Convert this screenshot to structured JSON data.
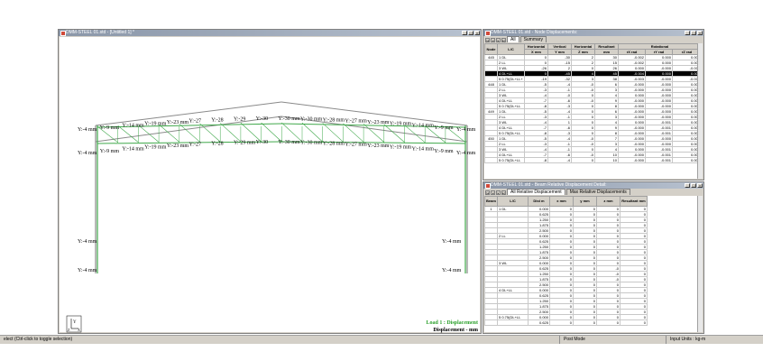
{
  "main_window": {
    "title": "DMM-STEEL 01.std - [Untitled 1] *",
    "title_buttons": [
      "_",
      "□",
      "×"
    ],
    "labels_top_row": [
      "Y:-4 mm",
      "Y:-9 mm",
      "Y:-14 mm",
      "Y:-19 mm",
      "Y:-23 mm",
      "Y:-27",
      "Y:-28",
      "Y:-29",
      "Y:-30",
      "Y:-30 mm",
      "Y:-30 mm",
      "Y:-28 mm",
      "Y:-27 mm",
      "Y:-23 mm",
      "Y:-19 mm",
      "Y:-14 mm",
      "Y:-9 mm",
      "Y:-4 mm"
    ],
    "labels_mid_row": [
      "Y:-4 mm",
      "Y:-9 mm",
      "Y:-14 mm",
      "Y:-19 mm",
      "Y:-23 mm",
      "Y:-27",
      "Y:-28",
      "Y:-29 mm",
      "Y:-30",
      "Y:-30 mm",
      "Y:-30 mm",
      "Y:-28 mm",
      "Y:-27 mm",
      "Y:-23 mm",
      "Y:-19 mm",
      "Y:-14 mm",
      "Y:-9 mm",
      "Y:-4 mm"
    ],
    "labels_low": [
      "Y:-4 mm",
      "Y:-4 mm"
    ],
    "labels_base": [
      "Y:-4 mm",
      "Y:-4 mm"
    ],
    "legend_line1": "Load 1 : Displacement",
    "legend_line2": "Displacement - mm",
    "axis_y": "Y",
    "axis_x": "X",
    "axis_z": "Z"
  },
  "node_disp": {
    "title": "DMM-STEEL 01.std - Node Displacements:",
    "tabs": [
      "All",
      "Summary"
    ],
    "header_groups": {
      "horizontal": "Horizontal",
      "vertical": "Vertical",
      "horizontal2": "Horizontal",
      "resultant": "Resultant",
      "rotational": "Rotational"
    },
    "columns": [
      "Node",
      "L/C",
      "X\nmm",
      "Y\nmm",
      "Z\nmm",
      "mm",
      "rX\nrad",
      "rY\nrad",
      "rZ\nrad"
    ],
    "rows": [
      [
        "445",
        "1 DL",
        "0",
        "-30",
        "2",
        "30",
        "-0.002",
        "0.000",
        "0.000"
      ],
      [
        "",
        "2 LL",
        "0",
        "-15",
        "2",
        "15",
        "-0.002",
        "0.000",
        "0.000"
      ],
      [
        "",
        "3 WL",
        "-26",
        "2",
        "0",
        "26",
        "0.000",
        "-0.000",
        "-0.000"
      ],
      [
        "",
        "4 DL+LL",
        "0",
        "-45",
        "4",
        "45",
        "-0.004",
        "0.000",
        "0.000"
      ],
      [
        "",
        "5 0.75(DL+LL+",
        "-19",
        "-32",
        "3",
        "38",
        "-0.003",
        "-0.000",
        "-0.000"
      ],
      [
        "448",
        "1 DL",
        "-5",
        "-4",
        "-0",
        "6",
        "-0.000",
        "-0.000",
        "0.001"
      ],
      [
        "",
        "2 LL",
        "-3",
        "-1",
        "-0",
        "3",
        "-0.000",
        "-0.000",
        "0.000"
      ],
      [
        "",
        "3 WL",
        "-4",
        "-0",
        "0",
        "4",
        "0.000",
        "-0.000",
        "0.003"
      ],
      [
        "",
        "4 DL+LL",
        "-7",
        "-6",
        "-0",
        "9",
        "-0.000",
        "-0.000",
        "0.001"
      ],
      [
        "",
        "5 0.75(DL+LL",
        "-8",
        "-3",
        "0",
        "8",
        "-0.000",
        "-0.000",
        "0.003"
      ],
      [
        "449",
        "1 DL",
        "-5",
        "-4",
        "0",
        "6",
        "-0.000",
        "-0.000",
        "0.001"
      ],
      [
        "",
        "2 LL",
        "-3",
        "-1",
        "0",
        "3",
        "-0.000",
        "-0.000",
        "0.000"
      ],
      [
        "",
        "3 WL",
        "-4",
        "1",
        "0",
        "4",
        "0.000",
        "-0.001",
        "0.003"
      ],
      [
        "",
        "4 DL+LL",
        "-7",
        "-6",
        "0",
        "9",
        "-0.000",
        "-0.001",
        "0.001"
      ],
      [
        "",
        "5 0.75(DL+LL",
        "-8",
        "-3",
        "0",
        "8",
        "-0.000",
        "-0.001",
        "0.003"
      ],
      [
        "450",
        "1 DL",
        "-5",
        "-4",
        "-0",
        "7",
        "-0.000",
        "-0.000",
        "0.001"
      ],
      [
        "",
        "2 LL",
        "-3",
        "-1",
        "-0",
        "3",
        "-0.000",
        "-0.000",
        "0.000"
      ],
      [
        "",
        "3 WL",
        "-4",
        "-1",
        "0",
        "4",
        "0.000",
        "-0.001",
        "0.003"
      ],
      [
        "",
        "4 DL+LL",
        "-7",
        "-6",
        "-0",
        "10",
        "-0.000",
        "-0.001",
        "0.001"
      ],
      [
        "",
        "5 0.75(DL+LL",
        "-8",
        "-4",
        "0",
        "10",
        "-0.000",
        "-0.001",
        "0.003"
      ]
    ]
  },
  "beam_disp": {
    "title": "DMM-STEEL 01.std - Beam Relative Displacement Detail:",
    "tabs": [
      "All Relative Displacement",
      "Max Relative Displacements"
    ],
    "columns": [
      "Beam",
      "L/C",
      "Dist\nm",
      "x\nmm",
      "y\nmm",
      "z\nmm",
      "Resultant\nmm"
    ],
    "rows": [
      [
        "1",
        "1 DL",
        "0.000",
        "0",
        "0",
        "0",
        "0"
      ],
      [
        "",
        "",
        "0.625",
        "0",
        "0",
        "0",
        "0"
      ],
      [
        "",
        "",
        "1.250",
        "0",
        "0",
        "0",
        "0"
      ],
      [
        "",
        "",
        "1.875",
        "0",
        "0",
        "0",
        "0"
      ],
      [
        "",
        "",
        "2.500",
        "0",
        "0",
        "0",
        "0"
      ],
      [
        "",
        "2 LL",
        "0.000",
        "0",
        "0",
        "0",
        "0"
      ],
      [
        "",
        "",
        "0.625",
        "0",
        "0",
        "0",
        "0"
      ],
      [
        "",
        "",
        "1.250",
        "0",
        "0",
        "0",
        "0"
      ],
      [
        "",
        "",
        "1.875",
        "0",
        "0",
        "0",
        "0"
      ],
      [
        "",
        "",
        "2.500",
        "0",
        "0",
        "0",
        "0"
      ],
      [
        "",
        "3 WL",
        "0.000",
        "0",
        "0",
        "0",
        "0"
      ],
      [
        "",
        "",
        "0.625",
        "0",
        "0",
        "-0",
        "0"
      ],
      [
        "",
        "",
        "1.250",
        "0",
        "0",
        "-0",
        "0"
      ],
      [
        "",
        "",
        "1.875",
        "0",
        "0",
        "-0",
        "0"
      ],
      [
        "",
        "",
        "2.500",
        "0",
        "0",
        "0",
        "0"
      ],
      [
        "",
        "4 DL+LL",
        "0.000",
        "0",
        "0",
        "0",
        "0"
      ],
      [
        "",
        "",
        "0.625",
        "0",
        "0",
        "0",
        "0"
      ],
      [
        "",
        "",
        "1.250",
        "0",
        "0",
        "0",
        "0"
      ],
      [
        "",
        "",
        "1.875",
        "0",
        "0",
        "0",
        "0"
      ],
      [
        "",
        "",
        "2.500",
        "0",
        "0",
        "0",
        "0"
      ],
      [
        "",
        "5 0.75(DL+LL",
        "0.000",
        "0",
        "0",
        "0",
        "0"
      ],
      [
        "",
        "",
        "0.625",
        "0",
        "0",
        "0",
        "0"
      ]
    ]
  },
  "status": {
    "left": "elect (Ctrl-click to toggle selection)",
    "mode": "Post Mode",
    "units": "Input Units : kg-m"
  }
}
